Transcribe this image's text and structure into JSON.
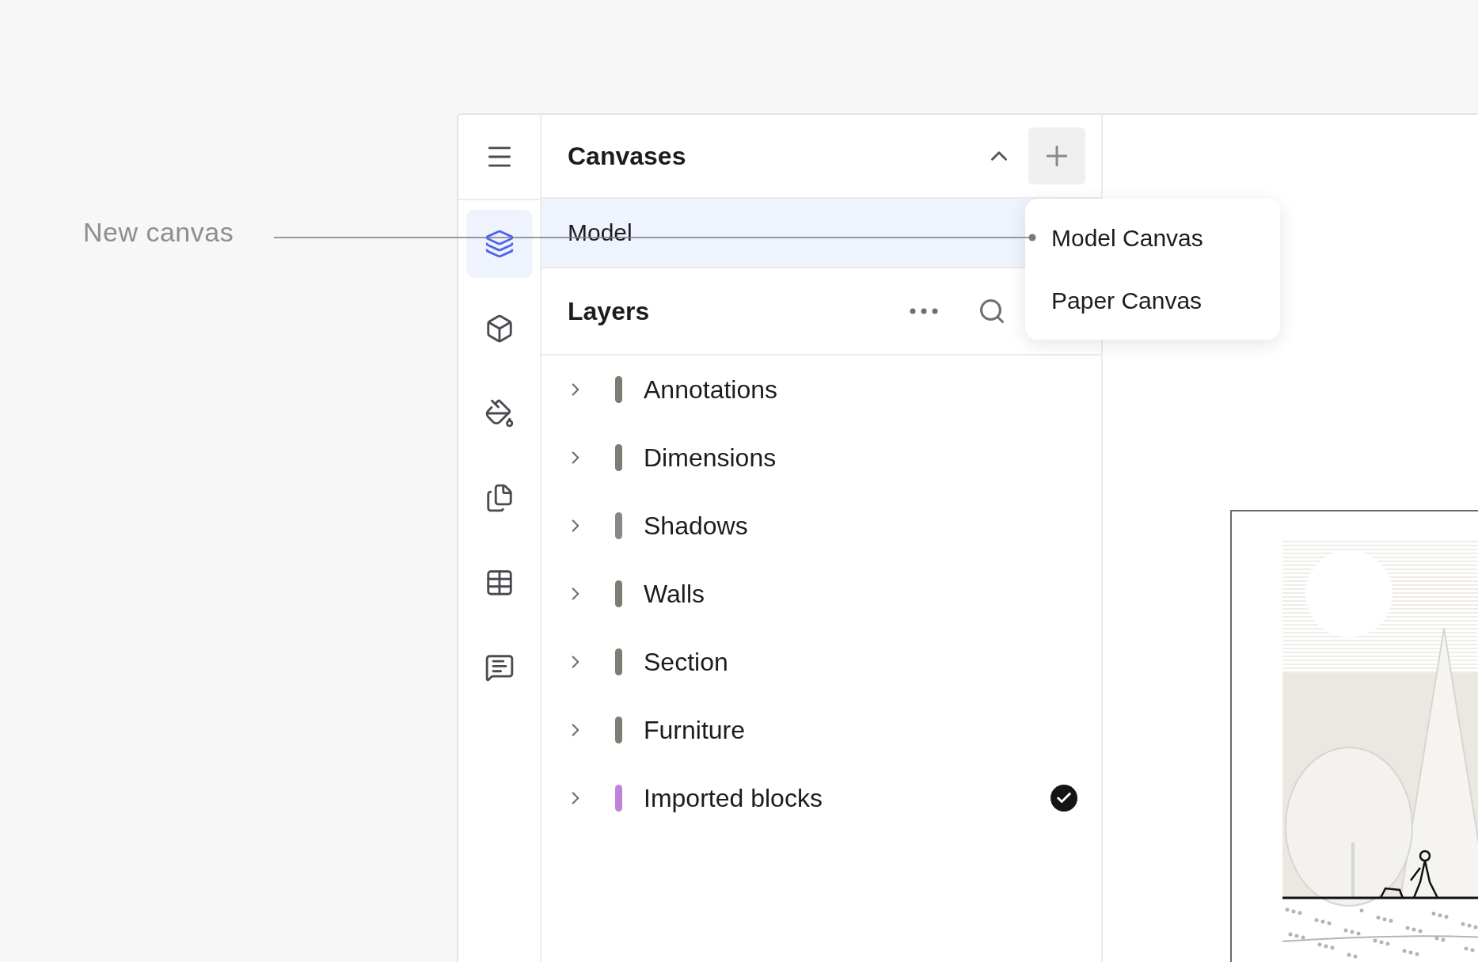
{
  "annotation": {
    "label": "New canvas"
  },
  "rail": {
    "items": [
      {
        "kind": "menu",
        "selected": false
      },
      {
        "kind": "layers",
        "selected": true
      },
      {
        "kind": "cube",
        "selected": false
      },
      {
        "kind": "bucket",
        "selected": false
      },
      {
        "kind": "pages",
        "selected": false
      },
      {
        "kind": "table",
        "selected": false
      },
      {
        "kind": "chat",
        "selected": false
      }
    ]
  },
  "canvases": {
    "title": "Canvases",
    "expanded": true,
    "items": [
      {
        "label": "Model",
        "selected": true
      }
    ]
  },
  "new_canvas_menu": {
    "items": [
      {
        "label": "Model Canvas"
      },
      {
        "label": "Paper Canvas"
      }
    ]
  },
  "layers": {
    "title": "Layers",
    "items": [
      {
        "label": "Annotations",
        "color": "#7b7d72",
        "expanded": false,
        "checked": false
      },
      {
        "label": "Dimensions",
        "color": "#7b7d72",
        "expanded": false,
        "checked": false
      },
      {
        "label": "Shadows",
        "color": "#88888c",
        "expanded": false,
        "checked": false
      },
      {
        "label": "Walls",
        "color": "#7b7d72",
        "expanded": false,
        "checked": false
      },
      {
        "label": "Section",
        "color": "#7b7d72",
        "expanded": false,
        "checked": false
      },
      {
        "label": "Furniture",
        "color": "#7b7d72",
        "expanded": false,
        "checked": false
      },
      {
        "label": "Imported blocks",
        "color": "#c083dc",
        "expanded": false,
        "checked": true
      }
    ]
  }
}
